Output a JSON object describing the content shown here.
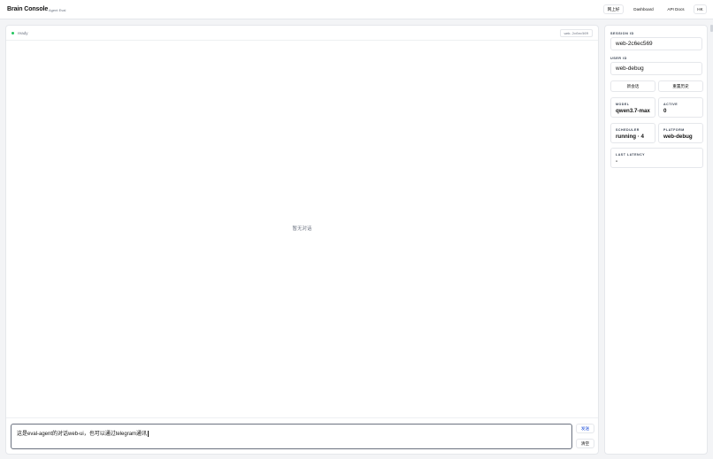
{
  "header": {
    "title": "Brain Console",
    "subtitle": "Agent Eval",
    "status_button": "网上好",
    "dashboard_link": "Dashboard",
    "api_docs_link": "API Docs",
    "lang_button": "HK"
  },
  "chat": {
    "status": "ready",
    "session_chip": "web-2c6ec569",
    "empty_text": "暂无对话",
    "input_value": "这是eval-agent的对话web-ui，也可以通过telegram通讯",
    "send_label": "发送",
    "clear_label": "清空"
  },
  "panel": {
    "session_id_label": "SESSION ID",
    "session_id_value": "web-2c6ec569",
    "user_id_label": "USER ID",
    "user_id_value": "web-debug",
    "new_session_button": "新会话",
    "reset_history_button": "重置历史",
    "cards": {
      "model": {
        "label": "MODEL",
        "value": "qwen3.7-max"
      },
      "active": {
        "label": "ACTIVE",
        "value": "0"
      },
      "scheduler": {
        "label": "SCHEDULER",
        "value": "running · 4"
      },
      "platform": {
        "label": "PLATFORM",
        "value": "web-debug"
      },
      "latency": {
        "label": "LAST LATENCY",
        "value": "-"
      }
    }
  },
  "colors": {
    "status_ok": "#22c55e",
    "send_accent": "#1d4ed8",
    "page_bg": "#f3f4f6"
  }
}
